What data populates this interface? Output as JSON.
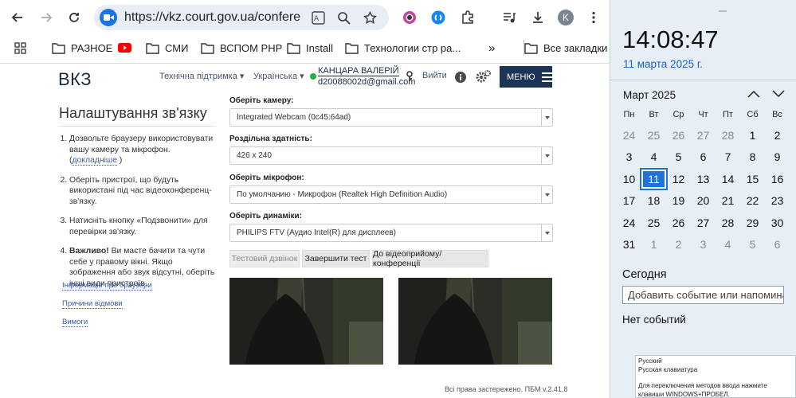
{
  "browser": {
    "url": "https://vkz.court.gov.ua/conferenc...",
    "avatar_letter": "K",
    "bookmarks": [
      "РАЗНОЕ",
      "СМИ",
      "ВСПОМ PHP",
      "Install",
      "Технологии стр ра...",
      "Все закладки"
    ],
    "more_bookmarks": "»"
  },
  "site": {
    "logo": "ВКЗ",
    "support_link": "Технічна підтримка ▾",
    "language_link": "Українська ▾",
    "user_name": "КАНЦАРА ВАЛЕРІЙ",
    "user_email": "d20088002d@gmail.com",
    "logout": "Вийти",
    "menu_label": "МЕНЮ"
  },
  "settings": {
    "title": "Налаштування зв'язку",
    "steps": [
      {
        "text": "Дозвольте браузеру використовувати вашу камеру та мікрофон. (",
        "link": "докладніше",
        "tail": " )"
      },
      {
        "text": "Оберіть пристрої, що будуть використані під час відеоконференц-зв'язку."
      },
      {
        "text": "Натисніть кнопку «Подзвонити» для перевірки зв'язку."
      },
      {
        "bold": "Важливо!",
        "text": " Ви маєте бачити та чути себе у правому вікні. Якщо зображення або звук відсутні, оберіть інші види пристроїв."
      }
    ],
    "side_links": [
      "Інформація про браузери",
      "Причини відмови",
      "Вимоги"
    ]
  },
  "form": {
    "camera_label": "Оберіть камеру:",
    "camera_value": "Integrated Webcam (0c45:64ad)",
    "resolution_label": "Роздільна здатність:",
    "resolution_value": "426 x 240",
    "mic_label": "Оберіть мікрофон:",
    "mic_value": "По умолчанию - Микрофон (Realtek High Definition Audio)",
    "speakers_label": "Оберіть динаміки:",
    "speakers_value": "PHILIPS FTV (Аудио Intel(R) для дисплеев)",
    "btn_test_call": "Тестовий дзвінок",
    "btn_finish_test": "Завершити тест",
    "btn_to_conference": "До відеоприйому/конференції"
  },
  "footer": {
    "copyright": "Всі права застережено. ПБМ v.2.41.8"
  },
  "calendar": {
    "time": "14:08:47",
    "date": "11 марта 2025 г.",
    "month": "Март 2025",
    "weekdays": [
      "Пн",
      "Вт",
      "Ср",
      "Чт",
      "Пт",
      "Сб",
      "Вс"
    ],
    "weeks": [
      [
        "24",
        "25",
        "26",
        "27",
        "28",
        "1",
        "2"
      ],
      [
        "3",
        "4",
        "5",
        "6",
        "7",
        "8",
        "9"
      ],
      [
        "10",
        "11",
        "12",
        "13",
        "14",
        "15",
        "16"
      ],
      [
        "17",
        "18",
        "19",
        "20",
        "21",
        "22",
        "23"
      ],
      [
        "24",
        "25",
        "26",
        "27",
        "28",
        "29",
        "30"
      ],
      [
        "31",
        "1",
        "2",
        "3",
        "4",
        "5",
        "6"
      ]
    ],
    "today": "11",
    "today_label": "Сегодня",
    "add_event_placeholder": "Добавить событие или напомина",
    "no_events": "Нет событий"
  },
  "ime_tooltip": {
    "line1": "Русский",
    "line2": "Русская клавиатура",
    "line3": "Для переключения методов ввода нажмите клавиши WINDOWS+ПРОБЕЛ."
  },
  "colors": {
    "accent": "#1c3557",
    "today": "#1e74d8",
    "link": "#3a5aa8",
    "online": "#27ae3a"
  }
}
